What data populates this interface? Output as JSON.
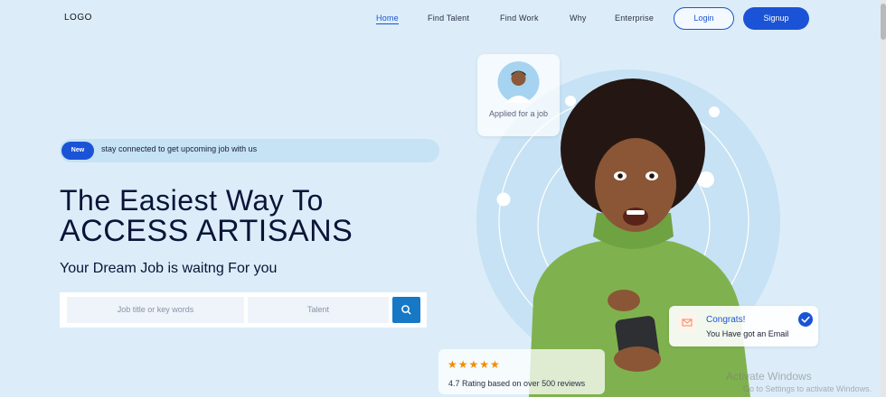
{
  "header": {
    "logo": "LOGO",
    "nav": [
      "Home",
      "Find Talent",
      "Find Work",
      "Why",
      "Enterprise"
    ],
    "login": "Login",
    "signup": "Signup"
  },
  "hero": {
    "badge": "New",
    "announcement": "stay connected to get upcoming job with us",
    "title_line1": "The Easiest Way To",
    "title_line2": "ACCESS ARTISANS",
    "subtitle": "Your Dream Job is waitng For you",
    "search": {
      "job_placeholder": "Job title or key words",
      "talent_placeholder": "Talent"
    }
  },
  "cards": {
    "applied": "Applied for a job",
    "congrats_title": "Congrats!",
    "congrats_text": "You Have got an Email",
    "rating_stars": "★★★★★",
    "rating_text": "4.7 Rating based on over 500 reviews"
  },
  "watermark": {
    "line1": "Activate Windows",
    "line2": "Go to Settings to activate Windows."
  },
  "colors": {
    "accent": "#1b53d6",
    "background": "#dcedf9",
    "sweater": "#7fb24e"
  },
  "icons": [
    "search-icon",
    "mail-icon",
    "check-icon"
  ]
}
